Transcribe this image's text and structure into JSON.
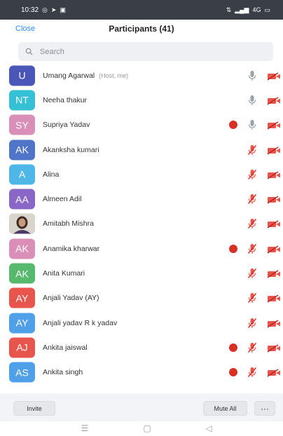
{
  "status_bar": {
    "time": "10:32",
    "left_icons": [
      "whatsapp-icon",
      "send-icon",
      "gallery-icon"
    ],
    "right_icons": [
      "network-icon",
      "signal-icon",
      "signal-4g-icon",
      "battery-icon"
    ]
  },
  "header": {
    "close_label": "Close",
    "title": "Participants (41)"
  },
  "search": {
    "placeholder": "Search"
  },
  "participants": [
    {
      "initials": "U",
      "name": "Umang Agarwal",
      "tag": "(Host, me)",
      "color": "#4a57b8",
      "hand": false,
      "mic": "on",
      "video": "off"
    },
    {
      "initials": "NT",
      "name": "Neeha thakur",
      "tag": "",
      "color": "#35c0d6",
      "hand": false,
      "mic": "on",
      "video": "off"
    },
    {
      "initials": "SY",
      "name": "Supriya Yadav",
      "tag": "",
      "color": "#d98fb8",
      "hand": true,
      "mic": "on",
      "video": "off"
    },
    {
      "initials": "AK",
      "name": "Akanksha kumari",
      "tag": "",
      "color": "#4f74c8",
      "hand": false,
      "mic": "muted",
      "video": "off"
    },
    {
      "initials": "A",
      "name": "Alina",
      "tag": "",
      "color": "#4fb6e8",
      "hand": false,
      "mic": "muted",
      "video": "off"
    },
    {
      "initials": "AA",
      "name": "Almeen Adil",
      "tag": "",
      "color": "#8a67c6",
      "hand": false,
      "mic": "muted",
      "video": "off"
    },
    {
      "initials": "",
      "name": "Amitabh Mishra",
      "tag": "",
      "color": "#6e5a4a",
      "hand": false,
      "mic": "muted",
      "video": "off",
      "photo": true
    },
    {
      "initials": "AK",
      "name": "Anamika kharwar",
      "tag": "",
      "color": "#d98fb8",
      "hand": true,
      "mic": "muted",
      "video": "off"
    },
    {
      "initials": "AK",
      "name": "Anita Kumari",
      "tag": "",
      "color": "#56b96d",
      "hand": false,
      "mic": "muted",
      "video": "off"
    },
    {
      "initials": "AY",
      "name": "Anjali Yadav (AY)",
      "tag": "",
      "color": "#e8554d",
      "hand": false,
      "mic": "muted",
      "video": "off"
    },
    {
      "initials": "AY",
      "name": "Anjali yadav R k yadav",
      "tag": "",
      "color": "#4fa0e8",
      "hand": false,
      "mic": "muted",
      "video": "off"
    },
    {
      "initials": "AJ",
      "name": "Ankita jaiswal",
      "tag": "",
      "color": "#e8554d",
      "hand": true,
      "mic": "muted",
      "video": "off"
    },
    {
      "initials": "AS",
      "name": "Ankita singh",
      "tag": "",
      "color": "#4fa0e8",
      "hand": true,
      "mic": "muted",
      "video": "off"
    },
    {
      "initials": "",
      "name": "",
      "tag": "",
      "color": "#8a67c6",
      "hand": false,
      "mic": "none",
      "video": "none",
      "partial": true
    }
  ],
  "footer": {
    "invite_label": "Invite",
    "mute_all_label": "Mute All",
    "more_label": "···"
  },
  "nav": {
    "items": [
      "menu-icon",
      "home-icon",
      "back-icon"
    ]
  },
  "colors": {
    "accent": "#2d8cff",
    "muted_red": "#d93025",
    "status_bar": "#3a3f47"
  }
}
